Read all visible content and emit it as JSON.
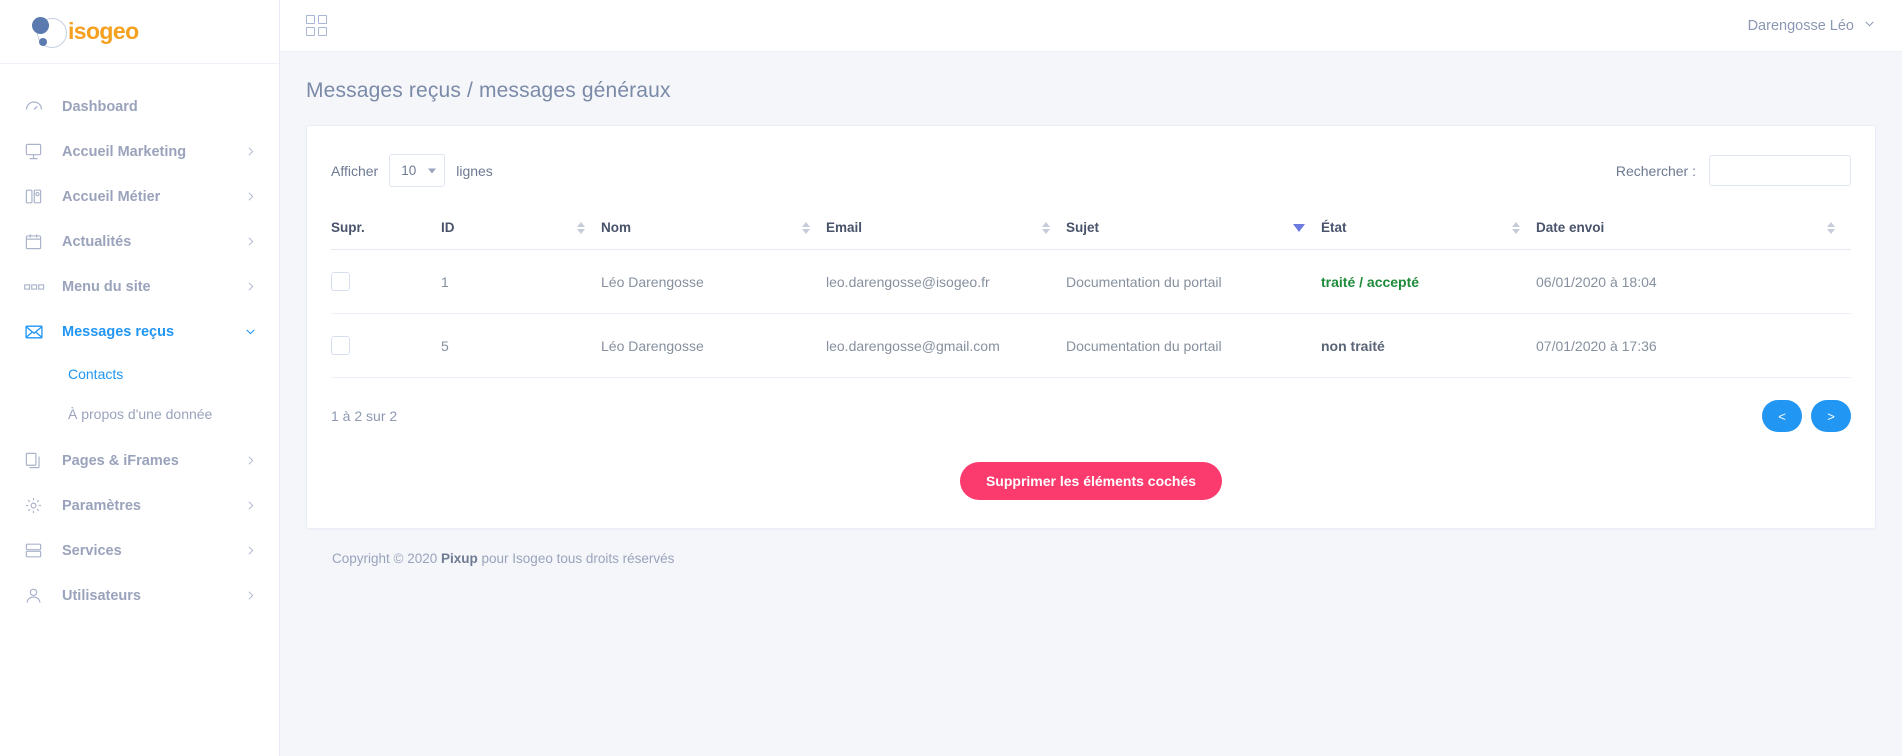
{
  "brand": {
    "name": "isogeo"
  },
  "topbar": {
    "grid_icon": "grid-menu-icon",
    "user_name": "Darengosse Léo"
  },
  "sidebar": {
    "items": [
      {
        "label": "Dashboard",
        "icon": "dashboard-icon",
        "expandable": false,
        "active": false
      },
      {
        "label": "Accueil Marketing",
        "icon": "monitor-icon",
        "expandable": true,
        "active": false
      },
      {
        "label": "Accueil Métier",
        "icon": "map-icon",
        "expandable": true,
        "active": false
      },
      {
        "label": "Actualités",
        "icon": "calendar-icon",
        "expandable": true,
        "active": false
      },
      {
        "label": "Menu du site",
        "icon": "menu-bars-icon",
        "expandable": true,
        "active": false
      },
      {
        "label": "Messages reçus",
        "icon": "envelope-icon",
        "expandable": true,
        "active": true
      },
      {
        "label": "Pages & iFrames",
        "icon": "copy-icon",
        "expandable": true,
        "active": false
      },
      {
        "label": "Paramètres",
        "icon": "gear-icon",
        "expandable": true,
        "active": false
      },
      {
        "label": "Services",
        "icon": "server-icon",
        "expandable": true,
        "active": false
      },
      {
        "label": "Utilisateurs",
        "icon": "user-icon",
        "expandable": true,
        "active": false
      }
    ],
    "submenu": [
      {
        "label": "Contacts",
        "active": true
      },
      {
        "label": "À propos d'une donnée",
        "active": false
      }
    ]
  },
  "page": {
    "title": "Messages reçus / messages généraux"
  },
  "controls": {
    "show_label": "Afficher",
    "page_length": "10",
    "rows_label": "lignes",
    "search_label": "Rechercher :",
    "search_value": "",
    "search_placeholder": ""
  },
  "table": {
    "columns": [
      {
        "label": "Supr.",
        "sortable": false,
        "sort": "none"
      },
      {
        "label": "ID",
        "sortable": true,
        "sort": "none"
      },
      {
        "label": "Nom",
        "sortable": true,
        "sort": "none"
      },
      {
        "label": "Email",
        "sortable": true,
        "sort": "none"
      },
      {
        "label": "Sujet",
        "sortable": true,
        "sort": "desc"
      },
      {
        "label": "État",
        "sortable": true,
        "sort": "none"
      },
      {
        "label": "Date envoi",
        "sortable": true,
        "sort": "none"
      }
    ],
    "rows": [
      {
        "checked": false,
        "id": "1",
        "nom": "Léo Darengosse",
        "email": "leo.darengosse@isogeo.fr",
        "sujet": "Documentation du portail",
        "etat": "traité / accepté",
        "etat_state": "ok",
        "date": "06/01/2020 à 18:04"
      },
      {
        "checked": false,
        "id": "5",
        "nom": "Léo Darengosse",
        "email": "leo.darengosse@gmail.com",
        "sujet": "Documentation du portail",
        "etat": "non traité",
        "etat_state": "no",
        "date": "07/01/2020 à 17:36"
      }
    ],
    "info": "1 à 2 sur 2",
    "pager": {
      "prev": "<",
      "next": ">"
    },
    "delete_button": "Supprimer les éléments cochés"
  },
  "footer": {
    "prefix": "Copyright © 2020 ",
    "company": "Pixup",
    "suffix": " pour Isogeo tous droits réservés"
  },
  "colors": {
    "accent_blue": "#2196f3",
    "brand_orange": "#f5a01e",
    "danger_pink": "#fb3a6e",
    "state_ok_green": "#1f8b3a",
    "sort_active": "#6c7ae0"
  }
}
